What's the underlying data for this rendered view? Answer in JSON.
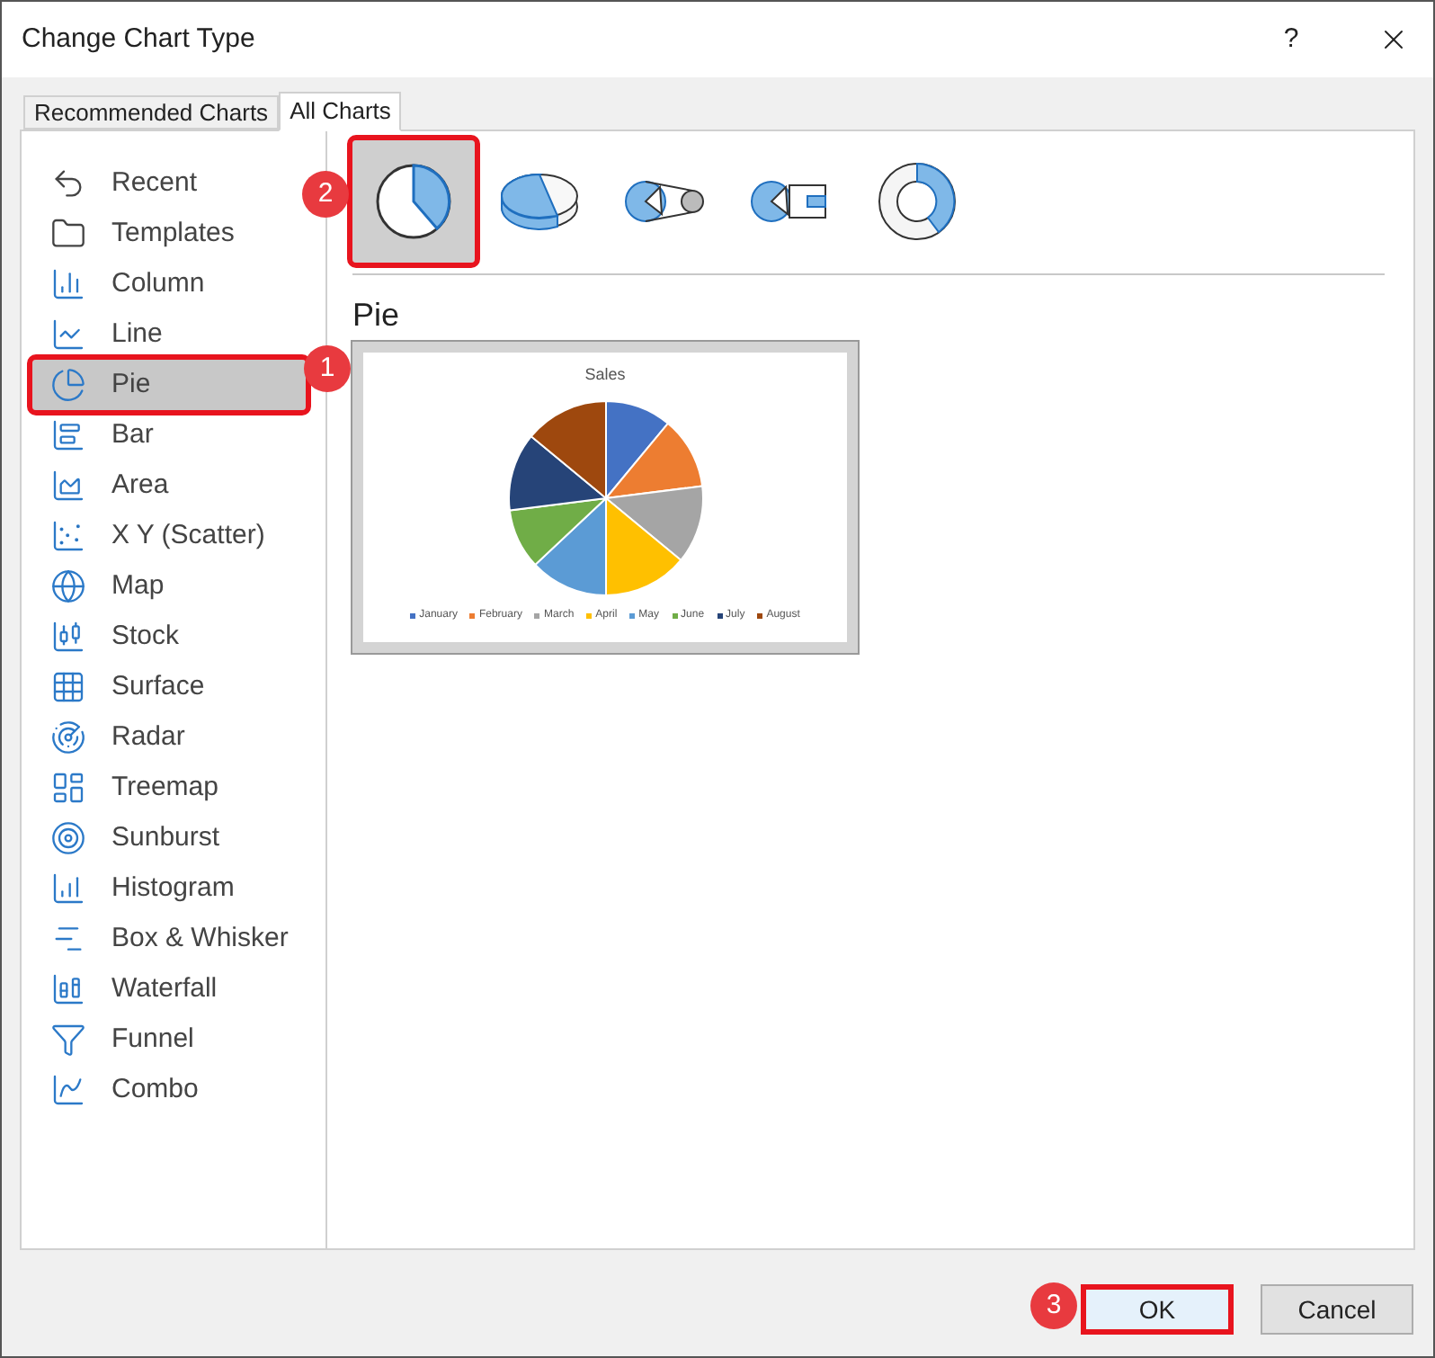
{
  "window": {
    "title": "Change Chart Type",
    "help": "?"
  },
  "tabs": [
    {
      "label": "Recommended Charts",
      "selected": false
    },
    {
      "label": "All Charts",
      "selected": true
    }
  ],
  "sidebar": {
    "items": [
      {
        "label": "Recent",
        "selected": false
      },
      {
        "label": "Templates",
        "selected": false
      },
      {
        "label": "Column",
        "selected": false
      },
      {
        "label": "Line",
        "selected": false
      },
      {
        "label": "Pie",
        "selected": true
      },
      {
        "label": "Bar",
        "selected": false
      },
      {
        "label": "Area",
        "selected": false
      },
      {
        "label": "X Y (Scatter)",
        "selected": false
      },
      {
        "label": "Map",
        "selected": false
      },
      {
        "label": "Stock",
        "selected": false
      },
      {
        "label": "Surface",
        "selected": false
      },
      {
        "label": "Radar",
        "selected": false
      },
      {
        "label": "Treemap",
        "selected": false
      },
      {
        "label": "Sunburst",
        "selected": false
      },
      {
        "label": "Histogram",
        "selected": false
      },
      {
        "label": "Box & Whisker",
        "selected": false
      },
      {
        "label": "Waterfall",
        "selected": false
      },
      {
        "label": "Funnel",
        "selected": false
      },
      {
        "label": "Combo",
        "selected": false
      }
    ]
  },
  "subtypes": [
    {
      "kind": "pie",
      "selected": true
    },
    {
      "kind": "pie3d",
      "selected": false
    },
    {
      "kind": "pieofpie",
      "selected": false
    },
    {
      "kind": "barofpie",
      "selected": false
    },
    {
      "kind": "doughnut",
      "selected": false
    }
  ],
  "preview": {
    "heading": "Pie",
    "chart_title": "Sales",
    "legend": [
      {
        "label": "January",
        "color": "#4472c4"
      },
      {
        "label": "February",
        "color": "#ed7d31"
      },
      {
        "label": "March",
        "color": "#a5a5a5"
      },
      {
        "label": "April",
        "color": "#ffc000"
      },
      {
        "label": "May",
        "color": "#5b9bd5"
      },
      {
        "label": "June",
        "color": "#70ad47"
      },
      {
        "label": "July",
        "color": "#264478"
      },
      {
        "label": "August",
        "color": "#9e480e"
      }
    ]
  },
  "buttons": [
    {
      "label": "OK",
      "highlighted": true
    },
    {
      "label": "Cancel",
      "highlighted": false
    }
  ],
  "callouts": [
    "1",
    "2",
    "3"
  ]
}
